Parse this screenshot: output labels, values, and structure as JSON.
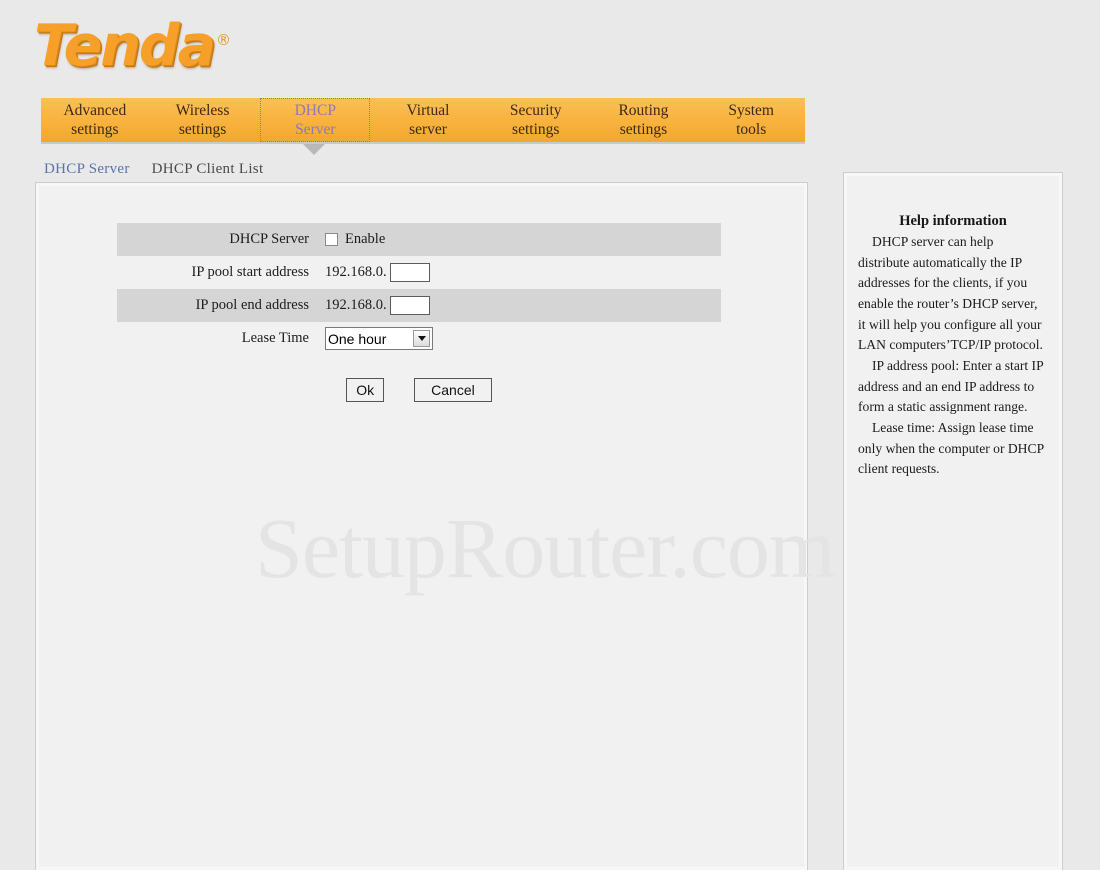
{
  "brand": {
    "name": "Tenda",
    "registered_mark": "®",
    "logo_color": "#f6a02a"
  },
  "main_nav": {
    "active_index": 2,
    "active_color": "#8e79b5",
    "background_color": "#f9b441",
    "tabs": [
      {
        "line1": "Advanced",
        "line2": "settings"
      },
      {
        "line1": "Wireless",
        "line2": "settings"
      },
      {
        "line1": "DHCP",
        "line2": "Server"
      },
      {
        "line1": "Virtual",
        "line2": "server"
      },
      {
        "line1": "Security",
        "line2": "settings"
      },
      {
        "line1": "Routing",
        "line2": "settings"
      },
      {
        "line1": "System",
        "line2": "tools"
      }
    ]
  },
  "sub_nav": {
    "active_index": 0,
    "active_color": "#5a73ad",
    "items": [
      {
        "label": "DHCP Server"
      },
      {
        "label": "DHCP Client List"
      }
    ]
  },
  "form": {
    "dhcp_server": {
      "label": "DHCP Server",
      "checkbox_label": "Enable",
      "checked": false
    },
    "pool_start": {
      "label": "IP pool start address",
      "prefix": "192.168.0.",
      "value": "",
      "placeholder": ""
    },
    "pool_end": {
      "label": "IP pool end address",
      "prefix": "192.168.0.",
      "value": "",
      "placeholder": ""
    },
    "lease_time": {
      "label": "Lease Time",
      "selected": "One hour",
      "options": [
        "One hour"
      ]
    },
    "buttons": {
      "ok": "Ok",
      "cancel": "Cancel"
    }
  },
  "help": {
    "title": "Help information",
    "paragraphs": [
      "DHCP server can help distribute automatically the IP addresses for the clients, if you enable the router’s DHCP server, it will help you configure all your LAN computers’TCP/IP protocol.",
      "IP address pool: Enter a start IP address and an end IP address to form a static assignment range.",
      "Lease time: Assign lease time only when the computer or DHCP client requests."
    ]
  },
  "watermark": {
    "text": "SetupRouter.com"
  }
}
